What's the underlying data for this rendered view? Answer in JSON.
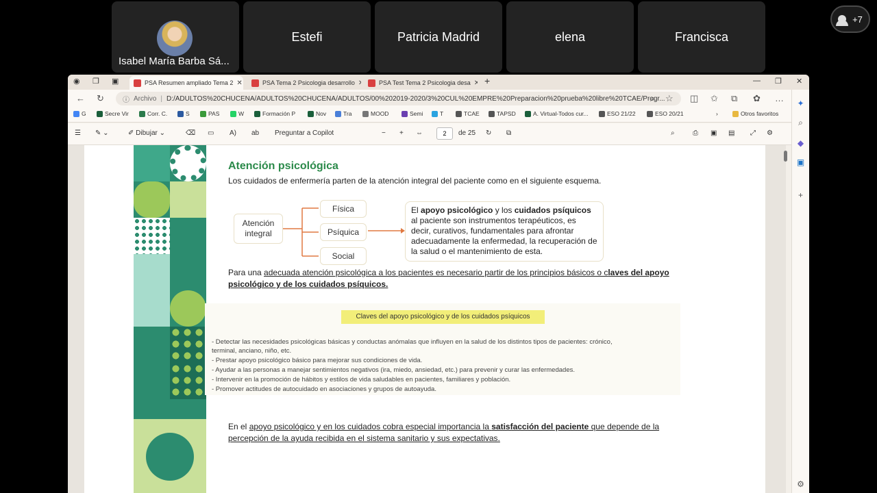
{
  "participants": [
    {
      "name": "Isabel María Barba Sá..."
    },
    {
      "name": "Estefi"
    },
    {
      "name": "Patricia Madrid"
    },
    {
      "name": "elena"
    },
    {
      "name": "Francisca"
    }
  ],
  "more_participants": "+7",
  "tabs": [
    {
      "label": "PSA Resumen ampliado Tema 2"
    },
    {
      "label": "PSA Tema 2 Psicologia desarrollo"
    },
    {
      "label": "PSA Test Tema 2 Psicologia desa"
    }
  ],
  "address": {
    "prefix": "Archivo",
    "url": "D:/ADULTOS%20CHUCENA/ADULTOS%20CHUCENA/ADULTOS/00%202019-2020/3%20CUL%20EMPRE%20Preparacion%20prueba%20libre%20TCAE/Progr..."
  },
  "bookmarks": [
    {
      "label": "G"
    },
    {
      "label": "Secre Vir"
    },
    {
      "label": "Corr. C."
    },
    {
      "label": "S"
    },
    {
      "label": "PAS"
    },
    {
      "label": "W"
    },
    {
      "label": "Formación P"
    },
    {
      "label": "Nov"
    },
    {
      "label": "Tra"
    },
    {
      "label": "MOOD"
    },
    {
      "label": "Semi"
    },
    {
      "label": "T"
    },
    {
      "label": "TCAE"
    },
    {
      "label": "TAPSD"
    },
    {
      "label": "A. Virtual-Todos cur..."
    },
    {
      "label": "ESO 21/22"
    },
    {
      "label": "ESO 20/21"
    },
    {
      "label": "Otros favoritos"
    }
  ],
  "pdf_toolbar": {
    "draw": "Dibujar",
    "copilot": "Preguntar a Copilot",
    "page": "2",
    "of": "de 25"
  },
  "doc": {
    "title": "Atención psicológica",
    "intro": "Los cuidados de enfermería parten de la atención integral del paciente como en el siguiente esquema.",
    "diagram": {
      "root": "Atención integral",
      "branches": [
        "Física",
        "Psíquica",
        "Social"
      ],
      "summary_parts": [
        "El ",
        "apoyo psicológico",
        " y los ",
        "cuidados psíquicos",
        " al paciente son instrumentos terapéuticos, es decir, curativos, fundamentales para afrontar adecuadamente la enfermedad, la recuperación de la salud o el mantenimiento de esta."
      ]
    },
    "para1_a": "Para una ",
    "para1_b": "adecuada atención psicológica a los pacientes es necesario partir de los principios básicos o c",
    "para1_c": "laves del apoyo psicológico y de los cuidados psíquicos.",
    "keys_title": "Claves del apoyo psicológico y de los cuidados psíquicos",
    "keys": [
      "- Detectar las necesidades psicológicas básicas y conductas anómalas que influyen en la salud de los distintos tipos de pacientes: crónico,",
      "  terminal, anciano, niño, etc.",
      "- Prestar apoyo psicológico básico para mejorar sus condiciones de vida.",
      "- Ayudar a las personas a manejar sentimientos negativos (ira, miedo, ansiedad, etc.) para prevenir y curar las enfermedades.",
      "- Intervenir en la promoción de hábitos y estilos de vida saludables en pacientes, familiares y población.",
      "- Promover actitudes de autocuidado en asociaciones y grupos de autoayuda."
    ],
    "para2_a": "En el ",
    "para2_b": "apoyo psicológico y en los cuidados cobra especial importancia la ",
    "para2_c": "satisfacción del paciente",
    "para2_d": " que depende de la",
    "para2_e": "percepción de la ayuda recibida en el sistema sanitario y sus expectativas."
  }
}
